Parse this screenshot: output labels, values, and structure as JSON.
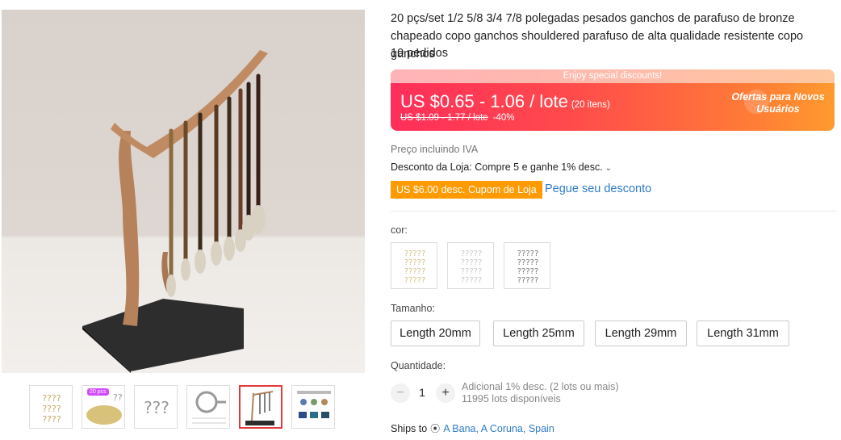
{
  "product": {
    "title": "20 pçs/set 1/2 5/8 3/4 7/8 polegadas pesados ganchos de parafuso de bronze chapeado copo ganchos shouldered parafuso de alta qualidade resistente copo ganchos",
    "orders": "10 pedidos"
  },
  "price": {
    "banner_text": "Enjoy special discounts!",
    "current": "US $0.65 - 1.06 / lote",
    "item_count": "(20 itens)",
    "original": "US $1.09 - 1.77 / lote",
    "discount": "-40%",
    "promo_label": "Ofertas para Novos Usuários",
    "colors": {
      "accent": "#ff2e5a",
      "accent_end": "#ff9a2e"
    }
  },
  "vat_note": "Preço incluindo IVA",
  "store_discount": "Desconto da Loja: Compre 5 e ganhe 1% desc.",
  "coupon": {
    "label": "US $6.00 desc. Cupom de Loja",
    "action": "Pegue seu desconto",
    "color": "#ff9b00"
  },
  "color_option": {
    "label": "cor:",
    "swatches": [
      {
        "name": "color-swatch-1",
        "icon": "hook-icon"
      },
      {
        "name": "color-swatch-2",
        "icon": "hook-icon"
      },
      {
        "name": "color-swatch-3",
        "icon": "hook-icon"
      }
    ]
  },
  "size_option": {
    "label": "Tamanho:",
    "options": [
      "Length 20mm",
      "Length 25mm",
      "Length 29mm",
      "Length 31mm"
    ]
  },
  "quantity": {
    "label": "Quantidade:",
    "value": "1",
    "decrement": "−",
    "increment": "+",
    "extra_discount": "Adicional 1% desc. (2 lots ou mais)",
    "available": "11995 lots disponíveis"
  },
  "shipping": {
    "label": "Ships to",
    "pin_icon": "location-pin-icon",
    "location": "A Bana, A Coruna, Spain"
  },
  "gallery": {
    "main_image": "brush-hanger-photo",
    "thumbnails": [
      {
        "name": "thumbnail-hooks-brass"
      },
      {
        "name": "thumbnail-hooks-pile",
        "tag": "20 pcs"
      },
      {
        "name": "thumbnail-hooks-finishes"
      },
      {
        "name": "thumbnail-hook-dimensions"
      },
      {
        "name": "thumbnail-brush-hanger",
        "active": true
      },
      {
        "name": "thumbnail-usage-chart"
      }
    ]
  }
}
